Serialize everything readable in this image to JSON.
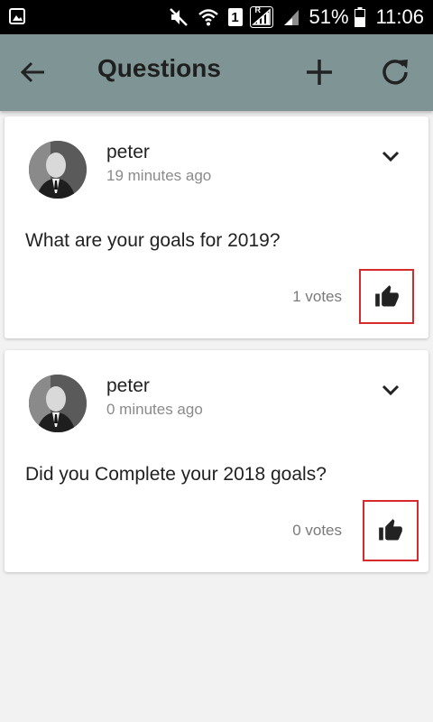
{
  "status_bar": {
    "sim_slot": "1",
    "roaming": "R",
    "battery_percent": "51%",
    "time": "11:06",
    "icons": [
      "gallery-icon",
      "mute-icon",
      "wifi-icon",
      "sim-icon",
      "signal-icon",
      "signal-icon",
      "battery-icon"
    ]
  },
  "app_bar": {
    "title": "Questions",
    "background_color": "#7f9494",
    "icons": [
      "arrow-back-icon",
      "plus-icon",
      "refresh-icon"
    ]
  },
  "questions": [
    {
      "author": "peter",
      "time_ago": "19 minutes ago",
      "text": "What are your goals for 2019?",
      "votes": "1 votes",
      "icons": [
        "avatar",
        "chevron-down-icon",
        "thumbs-up-icon"
      ]
    },
    {
      "author": "peter",
      "time_ago": "0 minutes ago",
      "text": "Did you Complete your 2018 goals?",
      "votes": "0 votes",
      "icons": [
        "avatar",
        "chevron-down-icon",
        "thumbs-up-icon"
      ]
    }
  ],
  "highlight_color": "#d62b2b"
}
